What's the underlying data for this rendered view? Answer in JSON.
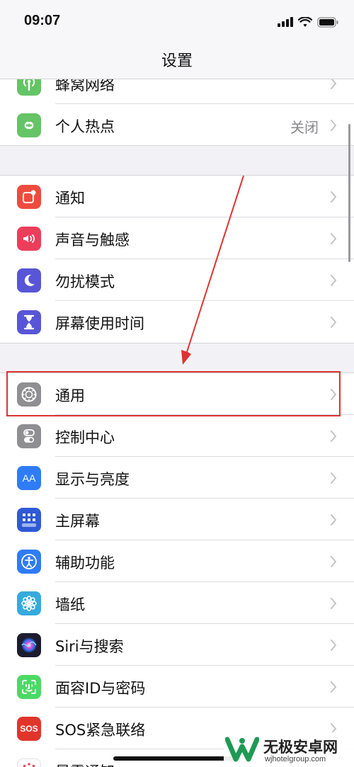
{
  "status_bar": {
    "time": "09:07"
  },
  "nav": {
    "title": "设置"
  },
  "groups": [
    {
      "items": [
        {
          "label": "蜂窝网络",
          "icon": "cellular-icon",
          "color": "#65c466"
        },
        {
          "label": "个人热点",
          "value": "关闭",
          "icon": "hotspot-icon",
          "color": "#65c466"
        }
      ]
    },
    {
      "items": [
        {
          "label": "通知",
          "icon": "notifications-icon",
          "color": "#ee4b3e"
        },
        {
          "label": "声音与触感",
          "icon": "sound-icon",
          "color": "#ec3d5a"
        },
        {
          "label": "勿扰模式",
          "icon": "moon-icon",
          "color": "#5856d6"
        },
        {
          "label": "屏幕使用时间",
          "icon": "hourglass-icon",
          "color": "#5856d6"
        }
      ]
    },
    {
      "items": [
        {
          "label": "通用",
          "icon": "gear-icon",
          "color": "#8e8e93",
          "highlighted": true
        },
        {
          "label": "控制中心",
          "icon": "toggles-icon",
          "color": "#8e8e93"
        },
        {
          "label": "显示与亮度",
          "icon": "display-aa-icon",
          "color": "#2f7cf6"
        },
        {
          "label": "主屏幕",
          "icon": "home-grid-icon",
          "color": "#2f5ad6"
        },
        {
          "label": "辅助功能",
          "icon": "accessibility-icon",
          "color": "#2f7cf6"
        },
        {
          "label": "墙纸",
          "icon": "wallpaper-flower-icon",
          "color": "#36aadc"
        },
        {
          "label": "Siri与搜索",
          "icon": "siri-icon",
          "color": "#1c1c2e"
        },
        {
          "label": "面容ID与密码",
          "icon": "face-id-icon",
          "color": "#4cd964"
        },
        {
          "label": "SOS紧急联络",
          "icon": "sos-icon",
          "color": "#e0352b",
          "icon_text": "SOS"
        },
        {
          "label": "暴露通知",
          "icon": "exposure-icon",
          "color": "#ffffff"
        }
      ]
    }
  ],
  "annotation": {
    "color": "#dd3333"
  },
  "watermark": {
    "name": "无极安卓网",
    "url": "wjhotelgroup.com"
  }
}
